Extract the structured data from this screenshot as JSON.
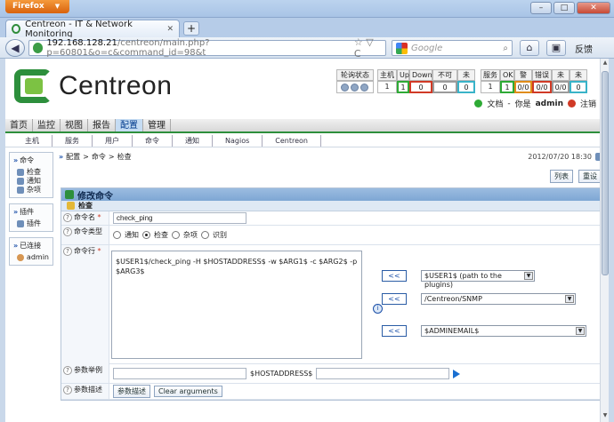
{
  "browser": {
    "menu_button": "Firefox",
    "tab_title": "Centreon - IT & Network Monitoring",
    "url_host": "192.168.128.21",
    "url_path": "/centreon/main.php?p=60801&o=c&command_id=98&t",
    "search_placeholder": "Google",
    "feedback_label": "反馈"
  },
  "header": {
    "logo_text": "Centreon",
    "poll_label": "轮询状态",
    "host_headers": [
      "主机",
      "Up",
      "Down",
      "不可达",
      "未决"
    ],
    "host_values": [
      "1",
      "1",
      "0",
      "0",
      "0"
    ],
    "service_headers": [
      "服务",
      "OK",
      "警告",
      "错误",
      "未知",
      "未决"
    ],
    "service_values": [
      "1",
      "1",
      "0/0",
      "0/0",
      "0/0",
      "0"
    ],
    "docs_label": "文档",
    "user_prefix": "你是",
    "user_name": "admin",
    "logout_label": "注销"
  },
  "main_menu": [
    {
      "label": "首页",
      "active": false
    },
    {
      "label": "监控",
      "active": false
    },
    {
      "label": "视图",
      "active": false
    },
    {
      "label": "报告",
      "active": false
    },
    {
      "label": "配置",
      "active": true
    },
    {
      "label": "管理",
      "active": false
    }
  ],
  "sub_menu": [
    "主机",
    "服务",
    "用户",
    "命令",
    "通知",
    "Nagios",
    "Centreon"
  ],
  "sidebar": {
    "commands_title": "命令",
    "commands_items": [
      "检查",
      "通知",
      "杂项"
    ],
    "plugins_title": "插件",
    "plugins_items": [
      "插件"
    ],
    "connected_title": "已连接",
    "connected_items": [
      "admin"
    ]
  },
  "breadcrumb": [
    "配置",
    "命令",
    "检查"
  ],
  "datetime": "2012/07/20 18:30",
  "list_button": "列表",
  "reset_button": "重设",
  "form": {
    "title": "修改命令",
    "section": "检查",
    "name_label": "命令名",
    "name_value": "check_ping",
    "type_label": "命令类型",
    "type_options": [
      "通知",
      "检查",
      "杂项",
      "识别"
    ],
    "type_selected": "检查",
    "line_label": "命令行",
    "command_line": "$USER1$/check_ping -H $HOSTADDRESS$ -w $ARG1$ -c $ARG2$ -p $ARG3$",
    "arrow_label": "<<",
    "macro_user": "$USER1$ (path to the plugins)",
    "macro_snmp": "/Centreon/SNMP",
    "macro_admin": "$ADMINEMAIL$",
    "example_label": "参数举例",
    "example_macro": "$HOSTADDRESS$",
    "desc_label": "参数描述",
    "desc_button": "参数描述",
    "clear_button": "Clear arguments"
  }
}
